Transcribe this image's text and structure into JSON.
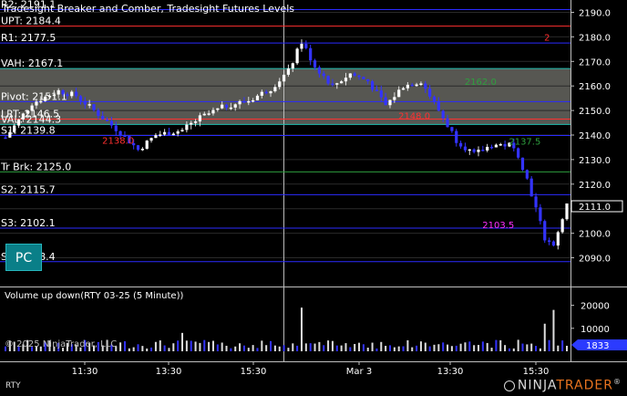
{
  "chart": {
    "title": "Tradesight Breaker and Comber, Tradesight Futures Levels",
    "subpanel_title": "Volume up down(RTY 03-25 (5 Minute))",
    "copyright": "© 2025 NinjaTrader, LLC",
    "instrument": "RTY",
    "pc_button": "PC",
    "current_price": "2111.0",
    "current_volume": "1833",
    "logo_left": "NINJA",
    "logo_right": "TRADER",
    "logo_reg": "®"
  },
  "levels": [
    {
      "label": "R2: 2191.1",
      "price": 2191.1,
      "color": "#2b2bff"
    },
    {
      "label": "UPT: 2184.4",
      "price": 2184.4,
      "color": "#ff3030"
    },
    {
      "label": "R1: 2177.5",
      "price": 2177.5,
      "color": "#2b2bff"
    },
    {
      "label": "VAH: 2167.1",
      "price": 2167.1,
      "color": "#20c0b0"
    },
    {
      "label": "Pivot: 2151.1",
      "price": 2153.6,
      "color": "#2b2bff"
    },
    {
      "label": "LRT: 2146.5",
      "price": 2146.5,
      "color": "#ff3030"
    },
    {
      "label": "VAL: 2144.3",
      "price": 2144.3,
      "color": "#20c0b0"
    },
    {
      "label": "S1: 2139.8",
      "price": 2139.8,
      "color": "#2b2bff"
    },
    {
      "label": "Tr Brk: 2125.0",
      "price": 2125.0,
      "color": "#2e9e3e"
    },
    {
      "label": "S2: 2115.7",
      "price": 2115.7,
      "color": "#2b2bff"
    },
    {
      "label": "S3: 2102.1",
      "price": 2102.1,
      "color": "#2b2bff"
    },
    {
      "label": "S4: 2088.4",
      "price": 2088.4,
      "color": "#2b2bff"
    }
  ],
  "annotations": [
    {
      "text": "2138.0",
      "price": 2138.0,
      "color": "#ff3030",
      "slot": 26
    },
    {
      "text": "2148.0",
      "price": 2148.0,
      "color": "#ff3030",
      "slot": 93
    },
    {
      "text": "2137.5",
      "price": 2137.5,
      "color": "#2e9e3e",
      "slot": 118
    },
    {
      "text": "2162.0",
      "price": 2162.0,
      "color": "#2e9e3e",
      "slot": 108
    },
    {
      "text": "2103.5",
      "price": 2103.5,
      "color": "#ff30ff",
      "slot": 112
    },
    {
      "text": "2",
      "price": 2180.0,
      "color": "#ff3030",
      "slot": 126
    }
  ],
  "y_axis_ticks": [
    2190.0,
    2180.0,
    2170.0,
    2160.0,
    2150.0,
    2140.0,
    2130.0,
    2120.0,
    2110.0,
    2100.0,
    2090.0
  ],
  "volume_ticks": [
    "20000",
    "10000"
  ],
  "x_axis": [
    "11:30",
    "13:30",
    "15:30",
    "Mar 3",
    "13:30",
    "15:30"
  ],
  "colors": {
    "up": "#ffffff",
    "down": "#3333ff",
    "band": "#666660",
    "accent": "#0a7f88"
  }
}
